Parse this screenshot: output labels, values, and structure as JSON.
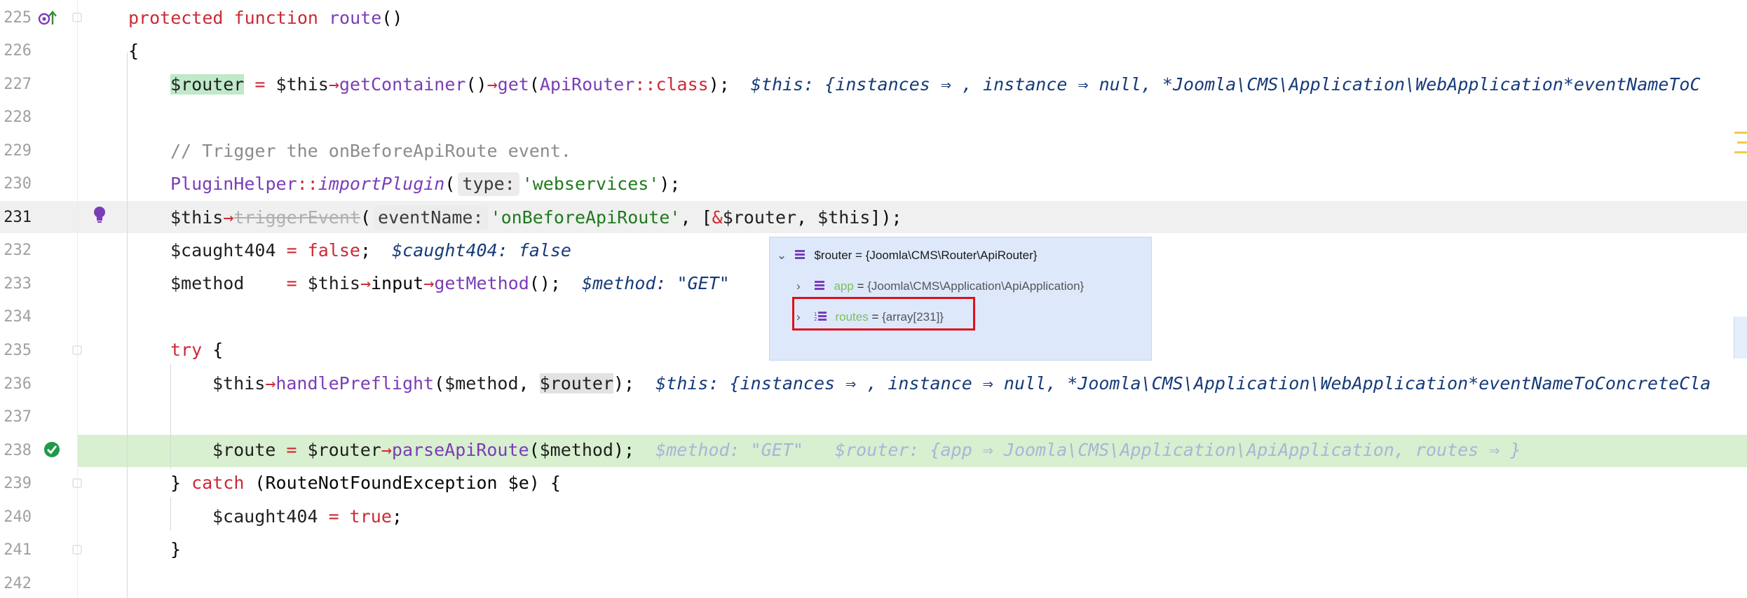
{
  "editor": {
    "line_numbers": [
      "225",
      "226",
      "227",
      "228",
      "229",
      "230",
      "231",
      "232",
      "233",
      "234",
      "235",
      "236",
      "237",
      "238",
      "239",
      "240",
      "241",
      "242"
    ],
    "current_line": "231",
    "lines": {
      "l225": {
        "kw": "protected function",
        "name": "route",
        "rest": "()"
      },
      "l226": {
        "text": "{"
      },
      "l227": {
        "var": "$router",
        "eq": " = ",
        "this": "$this",
        "arrow": "→",
        "call1": "getContainer",
        "p1": "()",
        "arrow2": "→",
        "call2": "get",
        "open": "(",
        "cls": "ApiRouter",
        "dc": "::",
        "clskw": "class",
        "close": ");",
        "inline": "$this: {instances ⇒ , instance ⇒ null, *Joomla\\CMS\\Application\\WebApplication*eventNameToC"
      },
      "l229": {
        "comment": "// Trigger the onBeforeApiRoute event."
      },
      "l230": {
        "cls": "PluginHelper",
        "dc": "::",
        "fn": "importPlugin",
        "open": "(",
        "hint": "type:",
        "str": "'webservices'",
        "close": ");"
      },
      "l231": {
        "this": "$this",
        "arrow": "→",
        "fn": "triggerEvent",
        "open": "(",
        "hint": "eventName:",
        "str": "'onBeforeApiRoute'",
        "mid": ", [",
        "amp": "&",
        "var": "$router",
        "sep": ", ",
        "this2": "$this",
        "close": "]);"
      },
      "l232": {
        "var": "$caught404",
        "eq": " = ",
        "kw": "false",
        "semi": ";",
        "inline": "$caught404: false"
      },
      "l233": {
        "var": "$method",
        "eq": "    = ",
        "this": "$this",
        "arrow": "→",
        "prop": "input",
        "arrow2": "→",
        "fn": "getMethod",
        "close": "();",
        "inline": "$method: \"GET\""
      },
      "l235": {
        "kw": "try",
        "rest": " {"
      },
      "l236": {
        "this": "$this",
        "arrow": "→",
        "fn": "handlePreflight",
        "open": "(",
        "arg": "$method",
        "sep": ", ",
        "var": "$router",
        "close": ");",
        "inline": "$this: {instances ⇒ , instance ⇒ null, *Joomla\\CMS\\Application\\WebApplication*eventNameToConcreteCla"
      },
      "l238": {
        "var": "$route",
        "eq": " = ",
        "var2": "$router",
        "arrow": "→",
        "fn": "parseApiRoute",
        "open": "(",
        "arg": "$method",
        "close": ");",
        "inline1": "$method: \"GET\"",
        "inline2": "$router: {app ⇒ Joomla\\CMS\\Application\\ApiApplication, routes ⇒ }"
      },
      "l239": {
        "pre": "} ",
        "kw": "catch",
        "rest": " (RouteNotFoundException $e) {"
      },
      "l240": {
        "var": "$caught404",
        "eq": " = ",
        "kw": "true",
        "semi": ";"
      },
      "l241": {
        "text": "}"
      }
    }
  },
  "popup": {
    "root": "$router = {Joomla\\CMS\\Router\\ApiRouter}",
    "items": [
      {
        "name": "app",
        "eq": " = ",
        "value": "{Joomla\\CMS\\Application\\ApiApplication}"
      },
      {
        "name": "routes",
        "eq": " = ",
        "value": "{array[231]}"
      }
    ]
  },
  "colors": {
    "keyword": "#cc2936",
    "function": "#7a3db8",
    "string": "#1f7a1f",
    "inline_value": "#163a7a",
    "exec_line_bg": "#d8efd0",
    "popup_bg": "#dde9fb",
    "highlight_box": "#e0101a"
  },
  "icons": {
    "l225": "override-method-icon",
    "l231": "lightbulb-icon",
    "l238": "execution-point-icon"
  }
}
